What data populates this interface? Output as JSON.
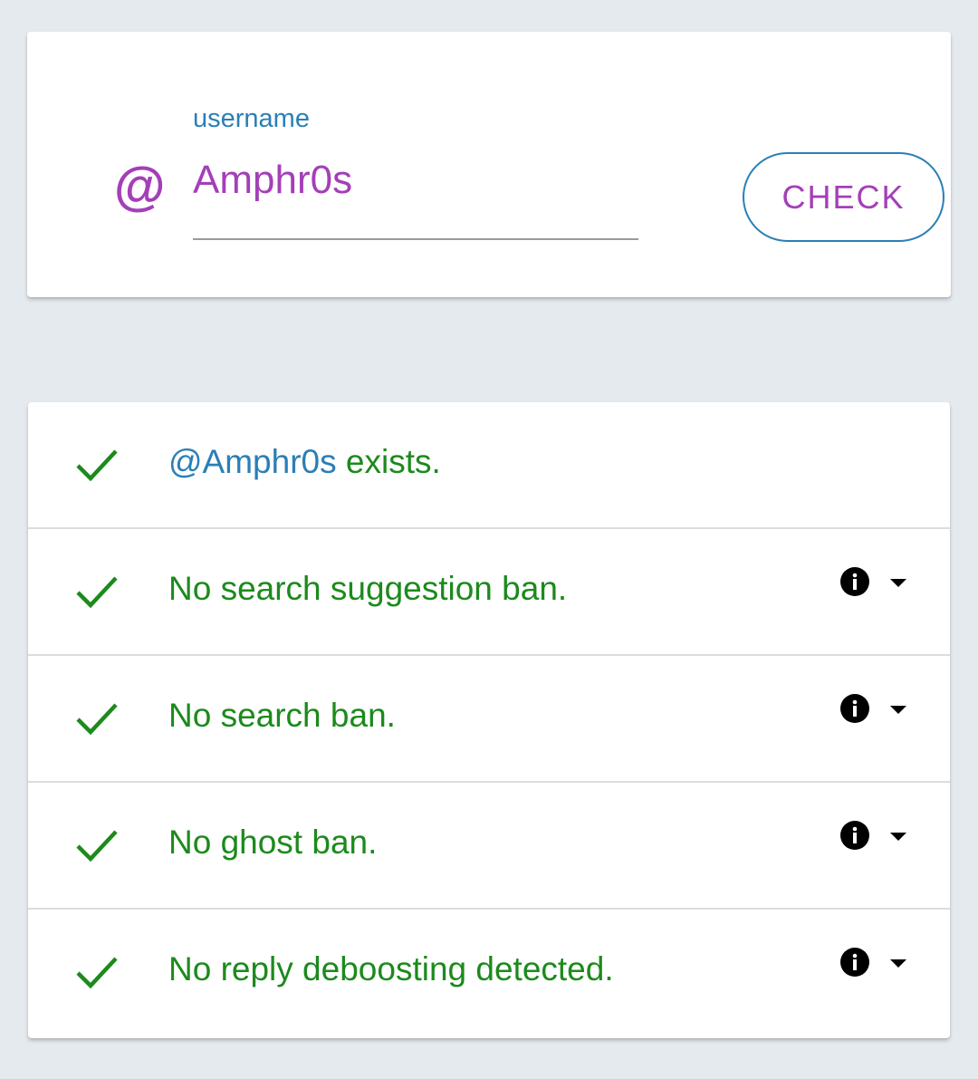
{
  "search": {
    "icon": "at-icon",
    "label": "username",
    "value": "Amphr0s",
    "button_label": "CHECK"
  },
  "results": [
    {
      "icon": "check-icon",
      "handle": "@Amphr0s",
      "text": " exists.",
      "has_info": false
    },
    {
      "icon": "check-icon",
      "text": "No search suggestion ban.",
      "has_info": true
    },
    {
      "icon": "check-icon",
      "text": "No search ban.",
      "has_info": true
    },
    {
      "icon": "check-icon",
      "text": "No ghost ban.",
      "has_info": true
    },
    {
      "icon": "check-icon",
      "text": "No reply deboosting detected.",
      "has_info": true
    }
  ],
  "colors": {
    "background": "#e5eaef",
    "accent_purple": "#a43fb8",
    "accent_blue": "#2a7fb6",
    "success_green": "#1c8a1c"
  }
}
